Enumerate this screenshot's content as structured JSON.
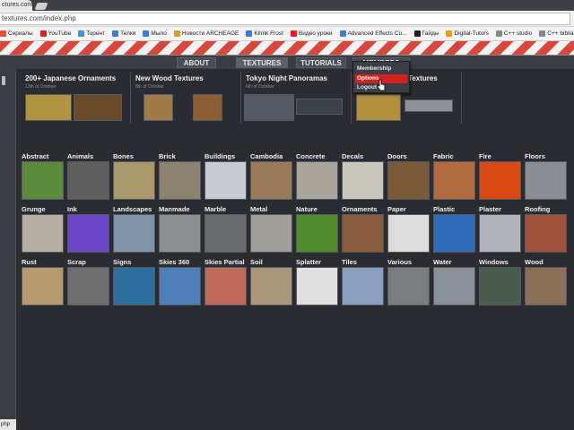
{
  "browser": {
    "tab_title": "ctures.com/index.php",
    "url": "textures.com/index.php",
    "bookmarks": [
      {
        "label": "Сериалы",
        "color": "#e74c3c",
        "icon": "tv-icon"
      },
      {
        "label": "YouTube",
        "color": "#e02020",
        "icon": "youtube-icon"
      },
      {
        "label": "Торент",
        "color": "#4a90d9",
        "icon": "torrent-icon"
      },
      {
        "label": "Телки",
        "color": "#3a7bd5",
        "icon": "folder-icon"
      },
      {
        "label": "Мыло",
        "color": "#3a7bd5",
        "icon": "mail-icon"
      },
      {
        "label": "Новости ARCHEAGE",
        "color": "#c9a227",
        "icon": "news-icon"
      },
      {
        "label": "Kilmk Frost",
        "color": "#3a7bd5",
        "icon": "frost-icon"
      },
      {
        "label": "Видео уроки",
        "color": "#e02020",
        "icon": "video-icon"
      },
      {
        "label": "Advanced Effects Cu...",
        "color": "#3a7bd5",
        "icon": "effects-icon"
      },
      {
        "label": "Гайды",
        "color": "#222222",
        "icon": "guides-icon"
      },
      {
        "label": "Digital-Tutors",
        "color": "#f39c12",
        "icon": "tutors-icon"
      },
      {
        "label": "C++ studio",
        "color": "#888888",
        "icon": "cpp-icon"
      },
      {
        "label": "C++ biblia",
        "color": "#888888",
        "icon": "cpp-bible-icon"
      }
    ],
    "status_text": "php"
  },
  "nav": {
    "items": [
      {
        "label": "ABOUT",
        "active": false
      },
      {
        "label": "TEXTURES",
        "active": true
      },
      {
        "label": "TUTORIALS",
        "active": false
      },
      {
        "label": "MEMBERS",
        "active": false
      }
    ]
  },
  "dropdown": {
    "items": [
      {
        "label": "Membership",
        "highlighted": false
      },
      {
        "label": "Options",
        "highlighted": true
      },
      {
        "label": "Logout",
        "highlighted": false
      }
    ]
  },
  "featured": [
    {
      "title": "200+ Japanese Ornaments",
      "date": "13th of October",
      "thumbs": [
        "#b09540",
        "#6b4a2a"
      ]
    },
    {
      "title": "New Wood Textures",
      "date": "8th of October",
      "thumbs": [
        "#a07a46",
        "#8a5c32"
      ]
    },
    {
      "title": "Tokyo Night Panoramas",
      "date": "6th of October",
      "thumbs": [
        "#555a62",
        "#3d4148"
      ]
    },
    {
      "title": "Textures",
      "date": "",
      "thumbs": [
        "#b3903e",
        "#8e9096"
      ]
    }
  ],
  "categories": [
    {
      "label": "Abstract",
      "color": "#5a8a3a"
    },
    {
      "label": "Animals",
      "color": "#5f5f5f"
    },
    {
      "label": "Bones",
      "color": "#a8986a"
    },
    {
      "label": "Brick",
      "color": "#8c8270"
    },
    {
      "label": "Buildings",
      "color": "#c8ccd0"
    },
    {
      "label": "Cambodia",
      "color": "#9a7a58"
    },
    {
      "label": "Concrete",
      "color": "#a9a59c"
    },
    {
      "label": "Decals",
      "color": "#c9c6bd"
    },
    {
      "label": "Doors",
      "color": "#7b5a38"
    },
    {
      "label": "Fabric",
      "color": "#b36a3e"
    },
    {
      "label": "Fire",
      "color": "#d84a12"
    },
    {
      "label": "Floors",
      "color": "#8a8d94"
    },
    {
      "label": "Grunge",
      "color": "#b6b0a2"
    },
    {
      "label": "Ink",
      "color": "#6a48c8"
    },
    {
      "label": "Landscapes",
      "color": "#7e93a6"
    },
    {
      "label": "Manmade",
      "color": "#8d8e92"
    },
    {
      "label": "Marble",
      "color": "#6a6b6d"
    },
    {
      "label": "Metal",
      "color": "#a09e99"
    },
    {
      "label": "Nature",
      "color": "#4f8b2c"
    },
    {
      "label": "Ornaments",
      "color": "#8a5a3e"
    },
    {
      "label": "Paper",
      "color": "#dcdcdc"
    },
    {
      "label": "Plastic",
      "color": "#2f6db8"
    },
    {
      "label": "Plaster",
      "color": "#b0b4b8"
    },
    {
      "label": "Roofing",
      "color": "#a0513a"
    },
    {
      "label": "Rust",
      "color": "#b79a6e"
    },
    {
      "label": "Scrap",
      "color": "#6e6e6e"
    },
    {
      "label": "Signs",
      "color": "#2c6fa0"
    },
    {
      "label": "Skies 360",
      "color": "#4e7fb8"
    },
    {
      "label": "Skies Partial",
      "color": "#c26a5a"
    },
    {
      "label": "Soil",
      "color": "#a9987a"
    },
    {
      "label": "Splatter",
      "color": "#e0e0e0"
    },
    {
      "label": "Tiles",
      "color": "#8ba0c0"
    },
    {
      "label": "Various",
      "color": "#7a7c80"
    },
    {
      "label": "Water",
      "color": "#8a9098"
    },
    {
      "label": "Windows",
      "color": "#4a5c50"
    },
    {
      "label": "Wood",
      "color": "#8a7058"
    }
  ]
}
